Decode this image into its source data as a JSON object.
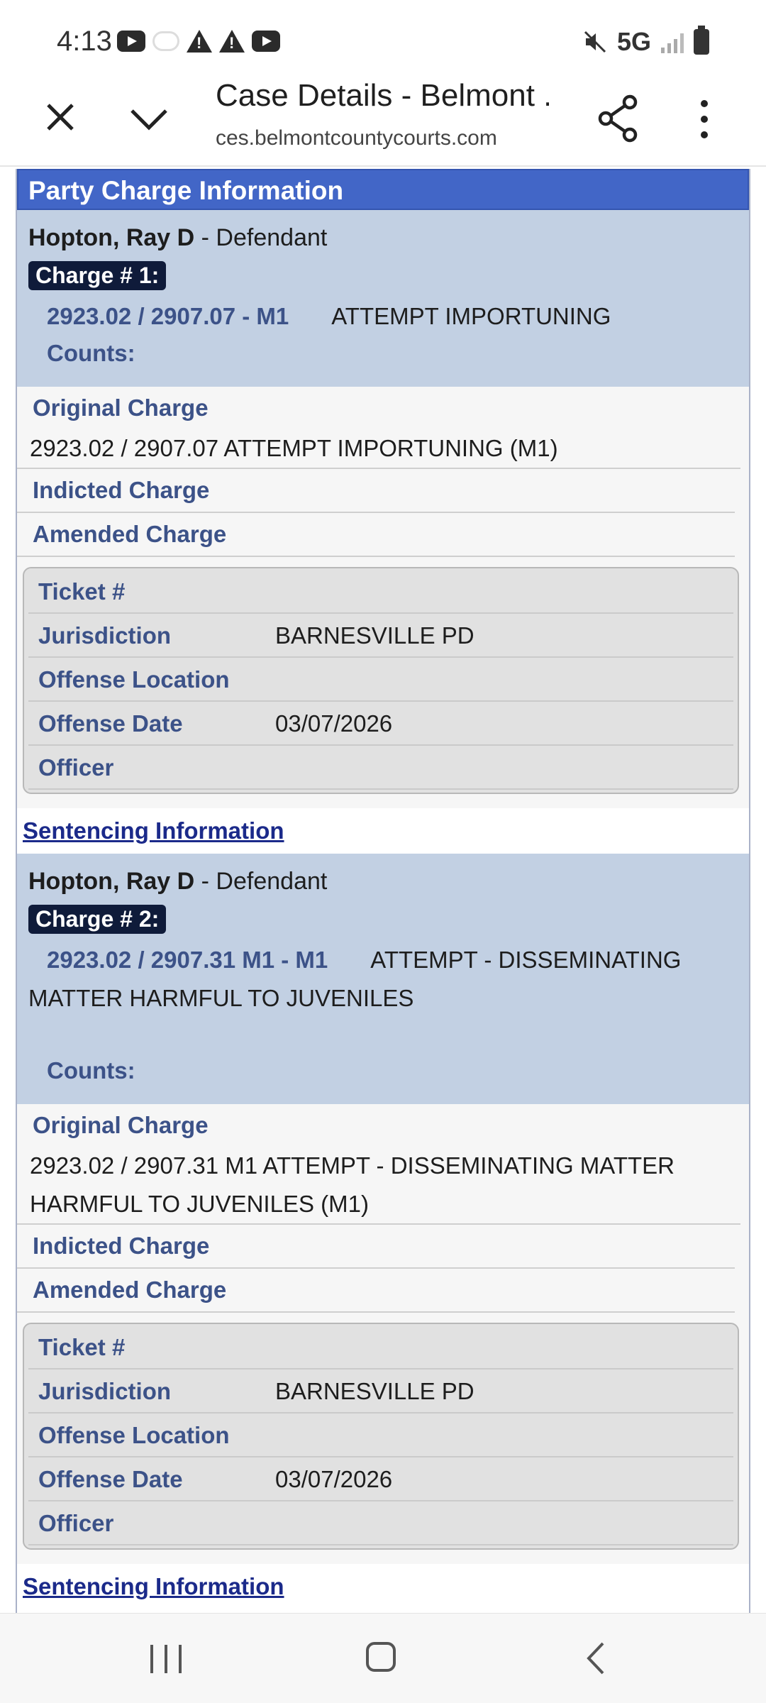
{
  "status_bar": {
    "time": "4:13",
    "network": "5G",
    "icons_left": [
      "youtube-icon",
      "cloud-icon",
      "warning-icon",
      "warning-icon",
      "youtube-icon"
    ],
    "icons_right": [
      "mute-icon",
      "signal-icon",
      "battery-icon"
    ]
  },
  "browser": {
    "title": "Case Details - Belmont ...",
    "url": "ces.belmontcountycourts.com"
  },
  "section": {
    "title": "Party Charge Information"
  },
  "labels": {
    "original_charge": "Original Charge",
    "indicted_charge": "Indicted Charge",
    "amended_charge": "Amended Charge",
    "ticket": "Ticket #",
    "jurisdiction": "Jurisdiction",
    "offense_location": "Offense Location",
    "offense_date": "Offense Date",
    "officer": "Officer",
    "counts": "Counts:",
    "sentencing": "Sentencing Information"
  },
  "charges": [
    {
      "party_name": "Hopton, Ray D",
      "party_role": " - Defendant",
      "badge": "Charge # 1:",
      "code": "2923.02 / 2907.07 - M1",
      "description": "ATTEMPT IMPORTUNING",
      "original_charge": "2923.02 / 2907.07 ATTEMPT IMPORTUNING (M1)",
      "ticket": "",
      "jurisdiction": "BARNESVILLE PD",
      "offense_location": "",
      "offense_date": "03/07/2026",
      "officer": ""
    },
    {
      "party_name": "Hopton, Ray D",
      "party_role": " - Defendant",
      "badge": "Charge # 2:",
      "code": "2923.02 / 2907.31 M1 - M1",
      "description": "ATTEMPT - DISSEMINATING MATTER HARMFUL TO JUVENILES",
      "original_charge": "2923.02 / 2907.31 M1 ATTEMPT - DISSEMINATING MATTER HARMFUL TO JUVENILES (M1)",
      "ticket": "",
      "jurisdiction": "BARNESVILLE PD",
      "offense_location": "",
      "offense_date": "03/07/2026",
      "officer": ""
    }
  ],
  "colors": {
    "header_blue": "#4266c7",
    "party_bg": "#c2d0e3",
    "badge_bg": "#0f1b3a",
    "label_blue": "#3c5288"
  }
}
